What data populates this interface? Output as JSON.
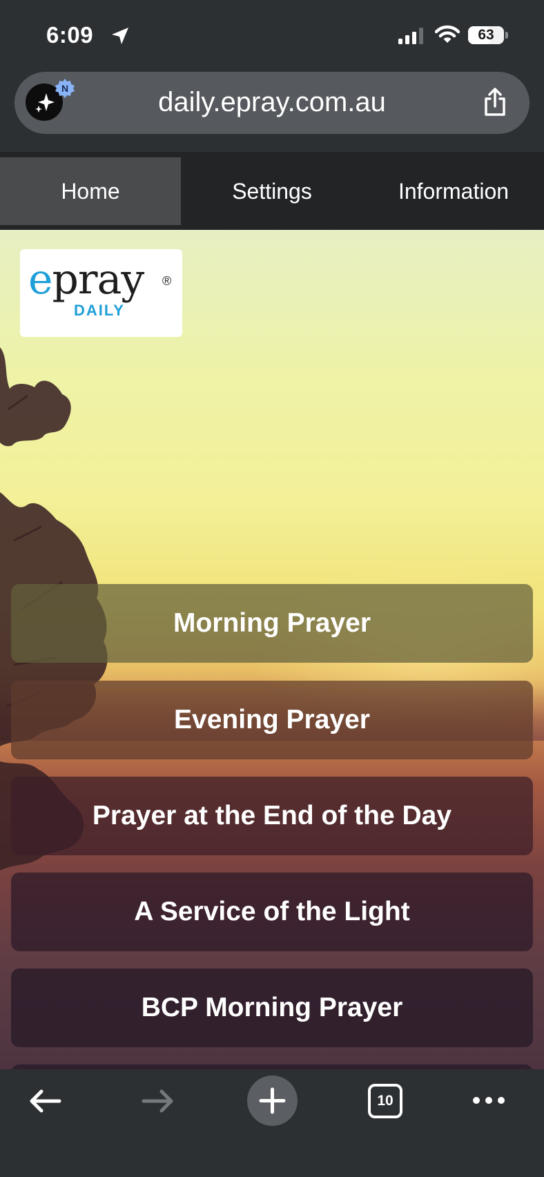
{
  "status_bar": {
    "time": "6:09",
    "battery": "63",
    "battery_fraction": 0.63,
    "icons": [
      "location-arrow-icon",
      "signal-icon",
      "wifi-icon",
      "battery-icon"
    ]
  },
  "browser": {
    "url": "daily.epray.com.au",
    "ai_badge": "N",
    "share_icon": "share-icon"
  },
  "nav": {
    "tabs": [
      {
        "label": "Home",
        "active": true
      },
      {
        "label": "Settings",
        "active": false
      },
      {
        "label": "Information",
        "active": false
      }
    ]
  },
  "logo": {
    "main": "pray",
    "e": "e",
    "reg": "®",
    "sub": "DAILY"
  },
  "prayers": [
    {
      "label": "Morning Prayer"
    },
    {
      "label": "Evening Prayer"
    },
    {
      "label": "Prayer at the End of the Day"
    },
    {
      "label": "A Service of the Light"
    },
    {
      "label": "BCP Morning Prayer"
    }
  ],
  "toolbar": {
    "tabs_count": "10",
    "icons": [
      "back-arrow-icon",
      "forward-arrow-icon",
      "new-tab-icon",
      "tabs-icon",
      "more-icon"
    ]
  },
  "colors": {
    "chrome_dark": "#2d3033",
    "nav_bg": "#222426",
    "nav_active": "#4a4b4d",
    "logo_blue": "#1e9fd8"
  }
}
